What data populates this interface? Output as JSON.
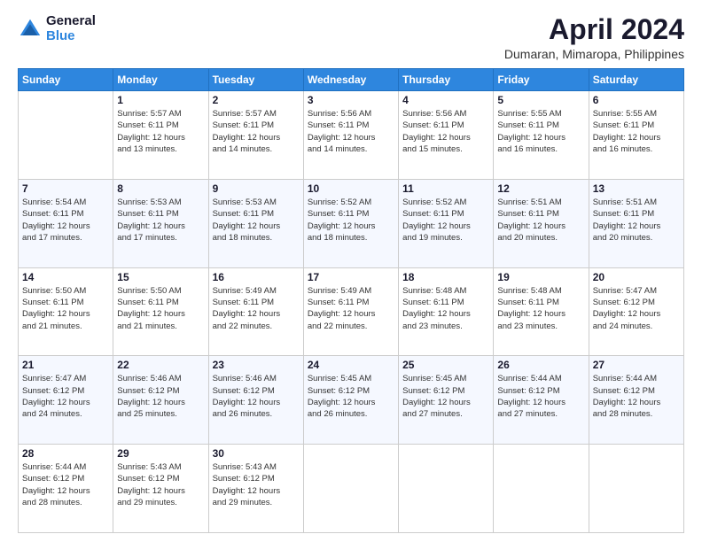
{
  "header": {
    "logo_line1": "General",
    "logo_line2": "Blue",
    "title": "April 2024",
    "subtitle": "Dumaran, Mimaropa, Philippines"
  },
  "calendar": {
    "days_of_week": [
      "Sunday",
      "Monday",
      "Tuesday",
      "Wednesday",
      "Thursday",
      "Friday",
      "Saturday"
    ],
    "weeks": [
      [
        {
          "day": "",
          "info": ""
        },
        {
          "day": "1",
          "info": "Sunrise: 5:57 AM\nSunset: 6:11 PM\nDaylight: 12 hours\nand 13 minutes."
        },
        {
          "day": "2",
          "info": "Sunrise: 5:57 AM\nSunset: 6:11 PM\nDaylight: 12 hours\nand 14 minutes."
        },
        {
          "day": "3",
          "info": "Sunrise: 5:56 AM\nSunset: 6:11 PM\nDaylight: 12 hours\nand 14 minutes."
        },
        {
          "day": "4",
          "info": "Sunrise: 5:56 AM\nSunset: 6:11 PM\nDaylight: 12 hours\nand 15 minutes."
        },
        {
          "day": "5",
          "info": "Sunrise: 5:55 AM\nSunset: 6:11 PM\nDaylight: 12 hours\nand 16 minutes."
        },
        {
          "day": "6",
          "info": "Sunrise: 5:55 AM\nSunset: 6:11 PM\nDaylight: 12 hours\nand 16 minutes."
        }
      ],
      [
        {
          "day": "7",
          "info": "Sunrise: 5:54 AM\nSunset: 6:11 PM\nDaylight: 12 hours\nand 17 minutes."
        },
        {
          "day": "8",
          "info": "Sunrise: 5:53 AM\nSunset: 6:11 PM\nDaylight: 12 hours\nand 17 minutes."
        },
        {
          "day": "9",
          "info": "Sunrise: 5:53 AM\nSunset: 6:11 PM\nDaylight: 12 hours\nand 18 minutes."
        },
        {
          "day": "10",
          "info": "Sunrise: 5:52 AM\nSunset: 6:11 PM\nDaylight: 12 hours\nand 18 minutes."
        },
        {
          "day": "11",
          "info": "Sunrise: 5:52 AM\nSunset: 6:11 PM\nDaylight: 12 hours\nand 19 minutes."
        },
        {
          "day": "12",
          "info": "Sunrise: 5:51 AM\nSunset: 6:11 PM\nDaylight: 12 hours\nand 20 minutes."
        },
        {
          "day": "13",
          "info": "Sunrise: 5:51 AM\nSunset: 6:11 PM\nDaylight: 12 hours\nand 20 minutes."
        }
      ],
      [
        {
          "day": "14",
          "info": "Sunrise: 5:50 AM\nSunset: 6:11 PM\nDaylight: 12 hours\nand 21 minutes."
        },
        {
          "day": "15",
          "info": "Sunrise: 5:50 AM\nSunset: 6:11 PM\nDaylight: 12 hours\nand 21 minutes."
        },
        {
          "day": "16",
          "info": "Sunrise: 5:49 AM\nSunset: 6:11 PM\nDaylight: 12 hours\nand 22 minutes."
        },
        {
          "day": "17",
          "info": "Sunrise: 5:49 AM\nSunset: 6:11 PM\nDaylight: 12 hours\nand 22 minutes."
        },
        {
          "day": "18",
          "info": "Sunrise: 5:48 AM\nSunset: 6:11 PM\nDaylight: 12 hours\nand 23 minutes."
        },
        {
          "day": "19",
          "info": "Sunrise: 5:48 AM\nSunset: 6:11 PM\nDaylight: 12 hours\nand 23 minutes."
        },
        {
          "day": "20",
          "info": "Sunrise: 5:47 AM\nSunset: 6:12 PM\nDaylight: 12 hours\nand 24 minutes."
        }
      ],
      [
        {
          "day": "21",
          "info": "Sunrise: 5:47 AM\nSunset: 6:12 PM\nDaylight: 12 hours\nand 24 minutes."
        },
        {
          "day": "22",
          "info": "Sunrise: 5:46 AM\nSunset: 6:12 PM\nDaylight: 12 hours\nand 25 minutes."
        },
        {
          "day": "23",
          "info": "Sunrise: 5:46 AM\nSunset: 6:12 PM\nDaylight: 12 hours\nand 26 minutes."
        },
        {
          "day": "24",
          "info": "Sunrise: 5:45 AM\nSunset: 6:12 PM\nDaylight: 12 hours\nand 26 minutes."
        },
        {
          "day": "25",
          "info": "Sunrise: 5:45 AM\nSunset: 6:12 PM\nDaylight: 12 hours\nand 27 minutes."
        },
        {
          "day": "26",
          "info": "Sunrise: 5:44 AM\nSunset: 6:12 PM\nDaylight: 12 hours\nand 27 minutes."
        },
        {
          "day": "27",
          "info": "Sunrise: 5:44 AM\nSunset: 6:12 PM\nDaylight: 12 hours\nand 28 minutes."
        }
      ],
      [
        {
          "day": "28",
          "info": "Sunrise: 5:44 AM\nSunset: 6:12 PM\nDaylight: 12 hours\nand 28 minutes."
        },
        {
          "day": "29",
          "info": "Sunrise: 5:43 AM\nSunset: 6:12 PM\nDaylight: 12 hours\nand 29 minutes."
        },
        {
          "day": "30",
          "info": "Sunrise: 5:43 AM\nSunset: 6:12 PM\nDaylight: 12 hours\nand 29 minutes."
        },
        {
          "day": "",
          "info": ""
        },
        {
          "day": "",
          "info": ""
        },
        {
          "day": "",
          "info": ""
        },
        {
          "day": "",
          "info": ""
        }
      ]
    ]
  }
}
